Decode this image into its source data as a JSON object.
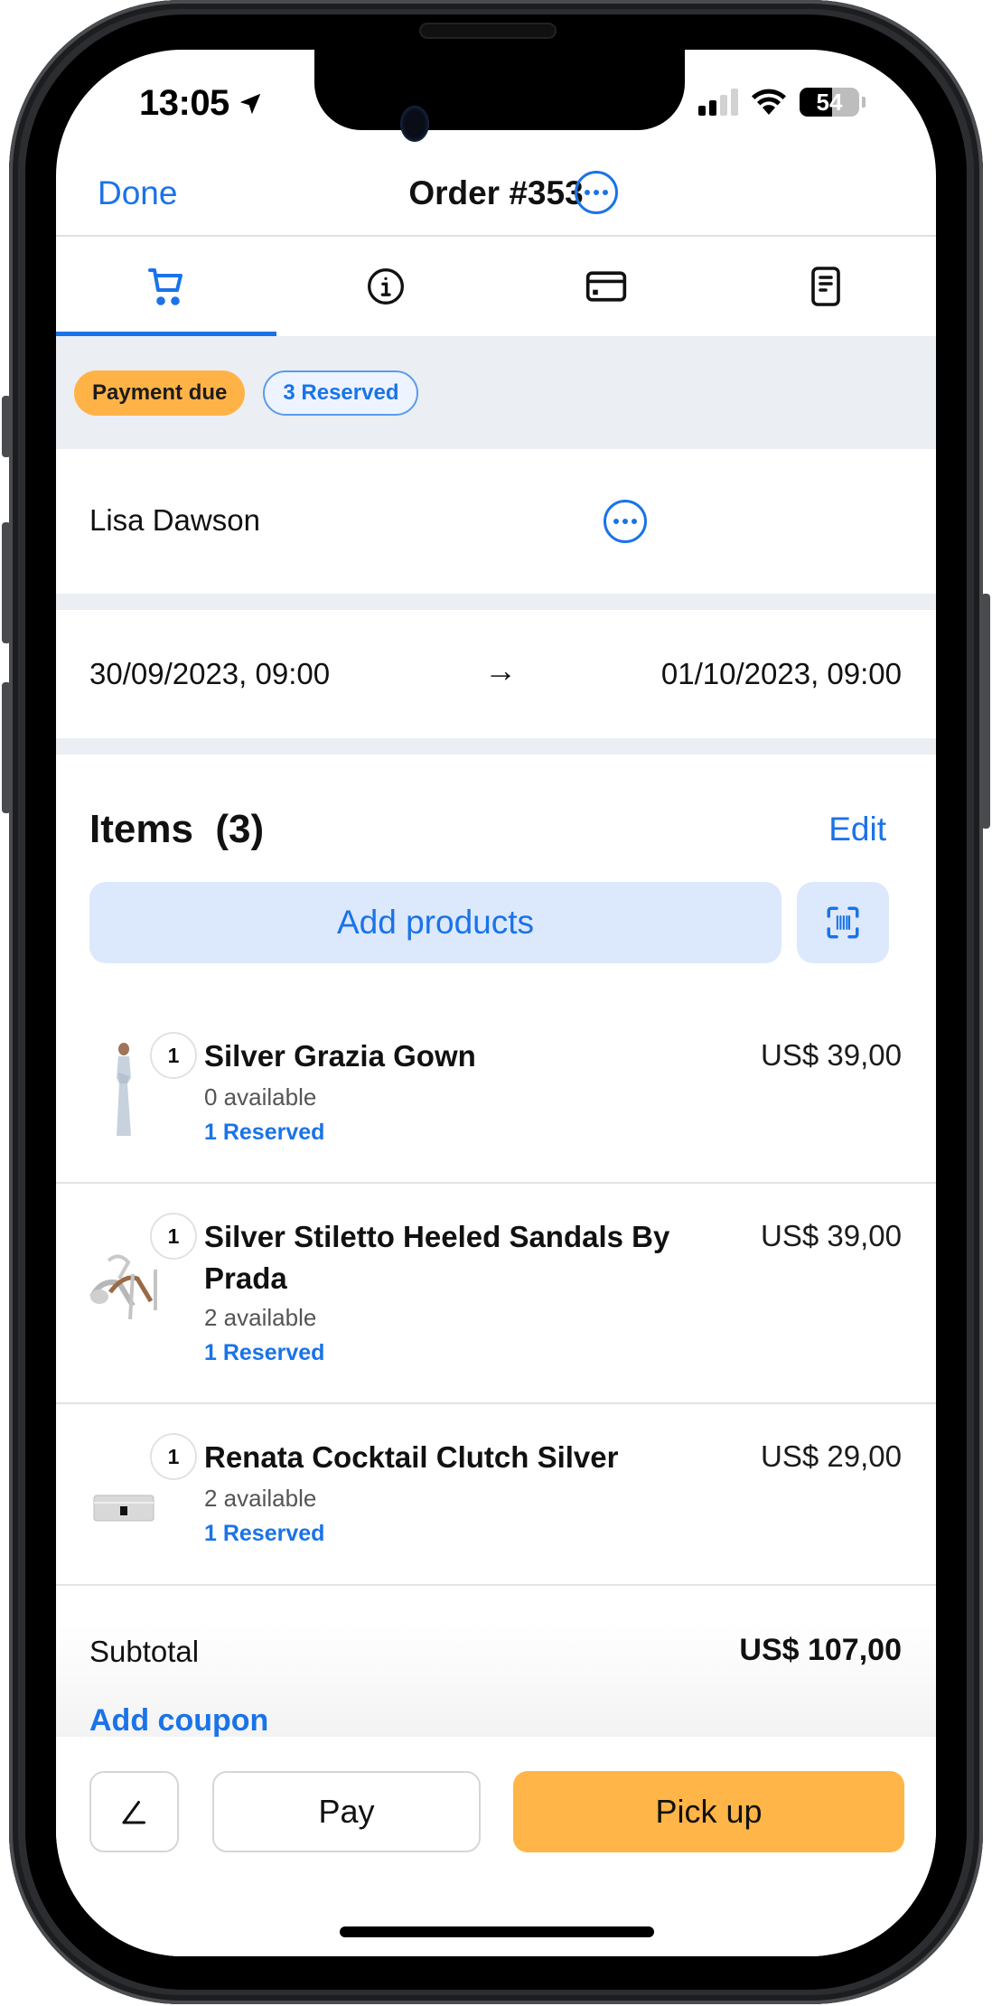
{
  "status_bar": {
    "time": "13:05",
    "location_icon": "location-arrow-icon",
    "signal_bars_filled": 2,
    "signal_bars_total": 4,
    "wifi_icon": "wifi-icon",
    "battery_percent": 54,
    "battery_label": "54"
  },
  "nav": {
    "done_label": "Done",
    "title": "Order #353",
    "more_icon": "ellipsis-circle-icon"
  },
  "tabs": [
    {
      "icon": "cart-icon",
      "active": true
    },
    {
      "icon": "info-icon",
      "active": false
    },
    {
      "icon": "credit-card-icon",
      "active": false
    },
    {
      "icon": "receipt-icon",
      "active": false
    }
  ],
  "badges": {
    "payment": "Payment due",
    "reserved": "3 Reserved"
  },
  "customer": {
    "name": "Lisa Dawson",
    "more_icon": "ellipsis-circle-icon"
  },
  "dates": {
    "start": "30/09/2023, 09:00",
    "arrow": "→",
    "end": "01/10/2023, 09:00"
  },
  "items_section": {
    "title": "Items  (3)",
    "edit_label": "Edit",
    "add_products_label": "Add products",
    "scan_icon": "barcode-scan-icon"
  },
  "items": [
    {
      "qty": "1",
      "name": "Silver Grazia Gown",
      "price": "US$ 39,00",
      "availability": "0 available",
      "reserved": "1 Reserved",
      "thumb": "gown-image"
    },
    {
      "qty": "1",
      "name": "Silver Stiletto Heeled Sandals By Prada",
      "price": "US$ 39,00",
      "availability": "2 available",
      "reserved": "1 Reserved",
      "thumb": "sandals-image"
    },
    {
      "qty": "1",
      "name": "Renata Cocktail Clutch Silver",
      "price": "US$ 29,00",
      "availability": "2 available",
      "reserved": "1 Reserved",
      "thumb": "clutch-image"
    }
  ],
  "summary": {
    "subtotal_label": "Subtotal",
    "subtotal_value": "US$ 107,00",
    "add_coupon_label": "Add coupon"
  },
  "actions": {
    "note_icon": "pencil-icon",
    "pay_label": "Pay",
    "pickup_label": "Pick up"
  },
  "colors": {
    "accent_blue": "#1a73e8",
    "payment_due_orange": "#ffb347",
    "pickup_orange": "#ffb547",
    "reserved_badge_bg": "#edf4ff",
    "add_products_bg": "#dce9fc",
    "section_grey": "#ebeef2"
  }
}
